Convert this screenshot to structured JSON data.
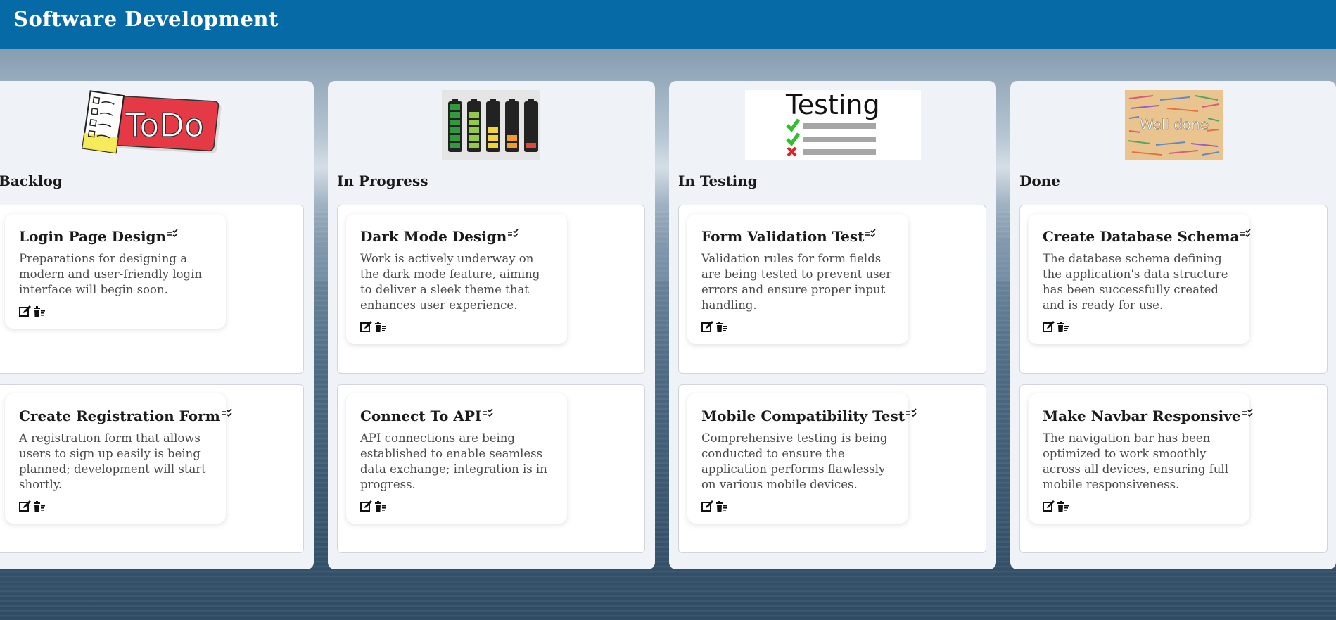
{
  "header": {
    "title": "Software Development",
    "background": "#066aa6"
  },
  "columns": [
    {
      "title": "Backlog",
      "logo": "todo-logo",
      "logo_text": "ToDo",
      "cards": [
        {
          "title": "Login Page Design",
          "description": "Preparations for designing a modern and user-friendly login interface will begin soon."
        },
        {
          "title": "Create Registration Form",
          "description": "A registration form that allows users to sign up easily is being planned; development will start shortly."
        }
      ]
    },
    {
      "title": "In Progress",
      "logo": "battery-levels-logo",
      "cards": [
        {
          "title": "Dark Mode Design",
          "description": "Work is actively underway on the dark mode feature, aiming to deliver a sleek theme that enhances user experience."
        },
        {
          "title": "Connect To API",
          "description": "API connections are being established to enable seamless data exchange; integration is in progress."
        }
      ]
    },
    {
      "title": "In Testing",
      "logo": "testing-checklist-logo",
      "logo_text": "Testing",
      "cards": [
        {
          "title": "Form Validation Test",
          "description": "Validation rules for form fields are being tested to prevent user errors and ensure proper input handling."
        },
        {
          "title": "Mobile Compatibility Test",
          "description": "Comprehensive testing is being conducted to ensure the application performs flawlessly on various mobile devices."
        }
      ]
    },
    {
      "title": "Done",
      "logo": "well-done-logo",
      "logo_text": "Well done",
      "cards": [
        {
          "title": "Create Database Schema",
          "description": "The database schema defining the application's data structure has been successfully created and is ready for use."
        },
        {
          "title": "Make Navbar Responsive",
          "description": "The navigation bar has been optimized to work smoothly across all devices, ensuring full mobile responsiveness."
        }
      ]
    }
  ],
  "card_icons": {
    "title_icon": "checklist-icon",
    "edit": "edit-icon",
    "delete": "delete-icon"
  }
}
